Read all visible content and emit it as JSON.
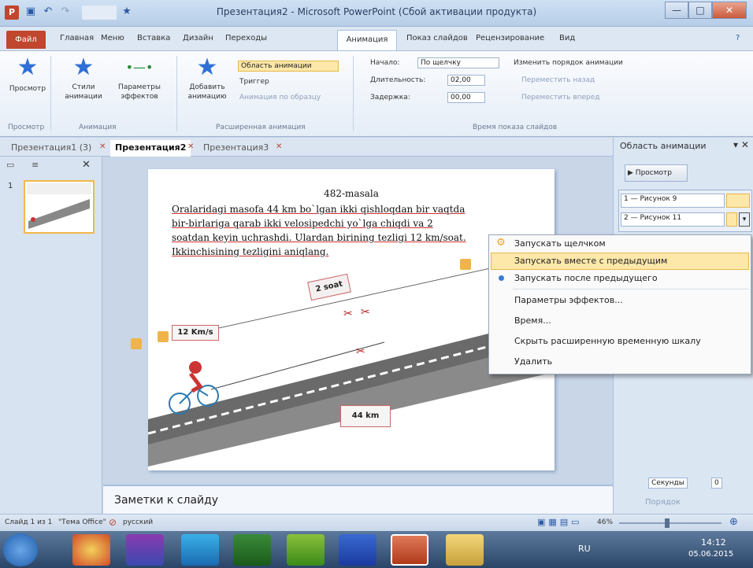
{
  "window": {
    "title": "Презентация2 - Microsoft PowerPoint (Сбой активации продукта)",
    "controls": [
      "—",
      "□",
      "✕"
    ]
  },
  "ribbon_tabs": {
    "file": "Файл",
    "items": [
      "Главная",
      "Меню",
      "Вставка",
      "Дизайн",
      "Переходы",
      "Анимация",
      "Показ слайдов",
      "Рецензирование",
      "Вид"
    ],
    "active": "Анимация"
  },
  "ribbon": {
    "preview": "Просмотр",
    "preview_group": "Просмотр",
    "styles": "Стили анимации",
    "effects": "Параметры эффектов",
    "anim_group": "Анимация",
    "add_anim": "Добавить анимацию",
    "anim_pane": "Область анимации",
    "trigger": "Триггер",
    "anim_by_sample": "Анимация по образцу",
    "ext_group": "Расширенная анимация",
    "start_label": "Начало:",
    "start_value": "По щелчку",
    "duration_label": "Длительность:",
    "duration_value": "02,00",
    "delay_label": "Задержка:",
    "delay_value": "00,00",
    "timing_group": "Время показа слайдов",
    "reorder": "Изменить порядок анимации",
    "move_back": "Переместить назад",
    "move_fwd": "Переместить вперед"
  },
  "doc_tabs": [
    {
      "label": "Презентация1 (3)"
    },
    {
      "label": "Презентация2"
    },
    {
      "label": "Презентация3"
    }
  ],
  "slide": {
    "title": "482-masala",
    "lines": [
      "Oralaridagi masofa 44 km bo`lgan ikki qishloqdan bir vaqtda",
      "bir-birlariga qarab ikki velosipedchi yo`lga chiqdi va 2",
      "soatdan keyin uchrashdi. Ulardan birining tezligi 12 km/soat.",
      "Ikkinchisining tezligini aniqlang."
    ],
    "label_2soat": "2 soat",
    "label_speed": "12 Km/s",
    "label_dist": "44 km"
  },
  "thumb": {
    "number": "1"
  },
  "notes": {
    "placeholder": "Заметки к слайду"
  },
  "anim_pane": {
    "title": "Область анимации",
    "play": "Просмотр",
    "items": [
      {
        "label": "1 — Рисунок 9"
      },
      {
        "label": "2 — Рисунок 11"
      }
    ],
    "seconds": "Секунды",
    "zoom": "0",
    "order": "Порядок"
  },
  "context_menu": {
    "items": [
      "Запускать щелчком",
      "Запускать вместе с предыдущим",
      "Запускать после предыдущего",
      "Параметры эффектов...",
      "Время...",
      "Скрыть расширенную временную шкалу",
      "Удалить"
    ],
    "highlighted": 1,
    "checked": 2
  },
  "status": {
    "slide": "Слайд 1 из 1",
    "theme": "\"Тема Office\"",
    "lang": "русский",
    "zoom": "46%"
  },
  "taskbar": {
    "lang": "RU",
    "time": "14:12",
    "date": "05.06.2015"
  },
  "colors": {
    "accent": "#c0462e",
    "highlight": "#fde7a9",
    "ribbon": "#e5edf7"
  }
}
